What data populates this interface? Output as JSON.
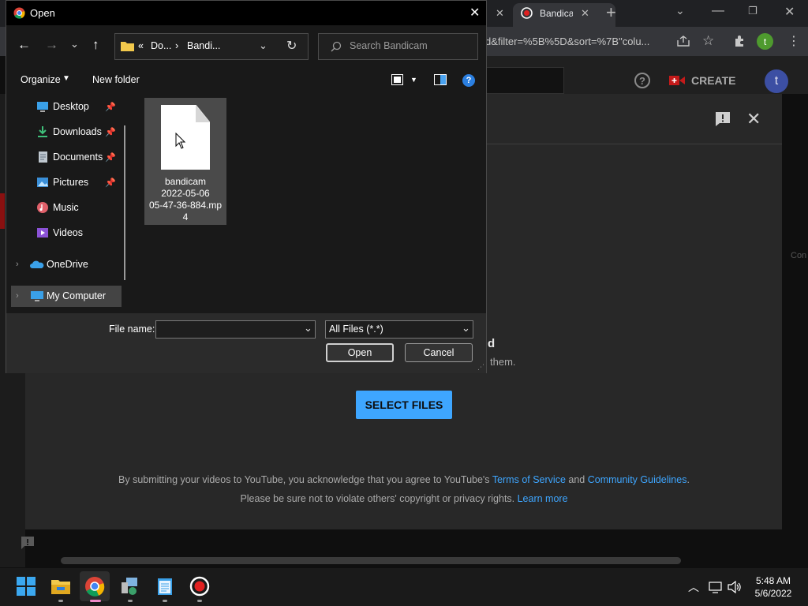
{
  "browser": {
    "tab_title": "Bandica",
    "url_fragment": "d&filter=%5B%5D&sort=%7B\"colu...",
    "new_tab_glyph": "+",
    "profile_initial": "t"
  },
  "youtube": {
    "create_label": "CREATE",
    "avatar_initial": "t",
    "drag_title_fragment": "d",
    "drag_subtitle_fragment": "them.",
    "select_files_label": "SELECT FILES",
    "side_fragment": "Con",
    "footer": {
      "line1_prefix": "By submitting your videos to YouTube, you acknowledge that you agree to YouTube's ",
      "tos_link": "Terms of Service",
      "and": " and ",
      "guidelines_link": "Community Guidelines",
      "line1_suffix": ".",
      "line2_prefix": "Please be sure not to violate others' copyright or privacy rights. ",
      "learn_more": "Learn more"
    }
  },
  "open_dialog": {
    "title": "Open",
    "path_parts": [
      "«",
      "Do...",
      "›",
      "Bandi..."
    ],
    "search_placeholder": "Search Bandicam",
    "organize_label": "Organize",
    "new_folder_label": "New folder",
    "nav_items": [
      {
        "label": "Desktop",
        "pinned": true,
        "icon": "desktop-icon"
      },
      {
        "label": "Downloads",
        "pinned": true,
        "icon": "downloads-icon"
      },
      {
        "label": "Documents",
        "pinned": true,
        "icon": "documents-icon"
      },
      {
        "label": "Pictures",
        "pinned": true,
        "icon": "pictures-icon"
      },
      {
        "label": "Music",
        "pinned": false,
        "icon": "music-icon"
      },
      {
        "label": "Videos",
        "pinned": false,
        "icon": "videos-icon"
      },
      {
        "label": "OneDrive",
        "pinned": false,
        "icon": "onedrive-icon"
      },
      {
        "label": "My Computer",
        "pinned": false,
        "icon": "computer-icon"
      }
    ],
    "file": {
      "line1": "bandicam",
      "line2": "2022-05-06",
      "line3": "05-47-36-884.mp",
      "line4": "4"
    },
    "file_name_label": "File name:",
    "file_name_value": "",
    "file_type_value": "All Files (*.*)",
    "open_button": "Open",
    "cancel_button": "Cancel"
  },
  "taskbar": {
    "time": "5:48 AM",
    "date": "5/6/2022"
  },
  "colors": {
    "accent": "#3ea6ff",
    "dialog_bg": "#191919",
    "youtube_bg": "#282828"
  }
}
